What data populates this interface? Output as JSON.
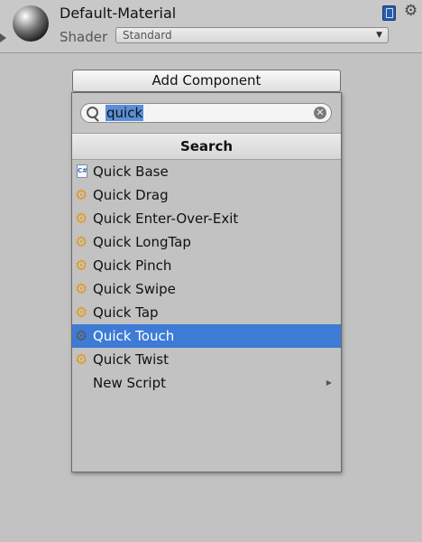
{
  "header": {
    "material_name": "Default-Material",
    "shader_label": "Shader",
    "shader_value": "Standard"
  },
  "add_component": {
    "label": "Add Component"
  },
  "search": {
    "value": "quick",
    "header": "Search"
  },
  "items": [
    {
      "label": "Quick Base",
      "icon": "csharp-file-icon"
    },
    {
      "label": "Quick Drag",
      "icon": "script-gear-icon"
    },
    {
      "label": "Quick Enter-Over-Exit",
      "icon": "script-gear-icon"
    },
    {
      "label": "Quick LongTap",
      "icon": "script-gear-icon"
    },
    {
      "label": "Quick Pinch",
      "icon": "script-gear-icon"
    },
    {
      "label": "Quick Swipe",
      "icon": "script-gear-icon"
    },
    {
      "label": "Quick Tap",
      "icon": "script-gear-icon"
    },
    {
      "label": "Quick Touch",
      "icon": "script-gear-icon",
      "selected": true
    },
    {
      "label": "Quick Twist",
      "icon": "script-gear-icon"
    },
    {
      "label": "New Script",
      "icon": "none",
      "submenu": true
    }
  ],
  "colors": {
    "selection": "#3d7bd6",
    "script_icon": "#e49a1c",
    "search_highlight": "#5b8fd8"
  }
}
